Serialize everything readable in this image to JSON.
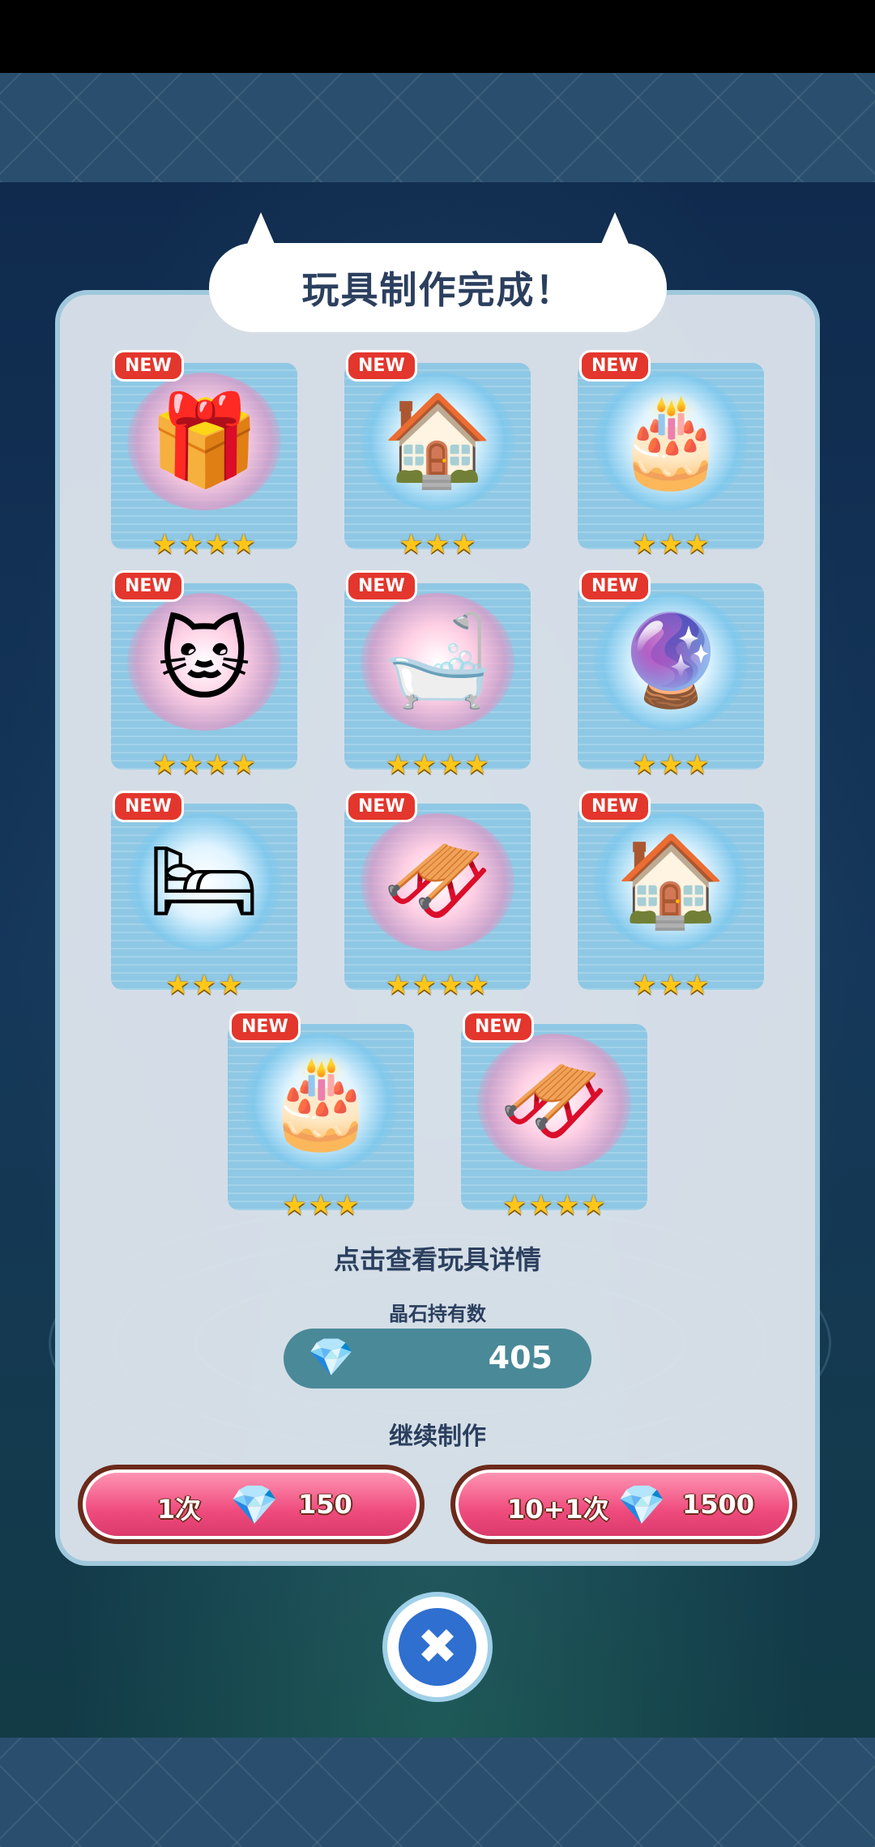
{
  "title": "玩具制作完成！",
  "new_badge": "NEW",
  "star_char": "★",
  "items": [
    {
      "toy_icon": "stacked-gift-boxes-icon",
      "emoji": "🎁",
      "stars": 4,
      "glow": "pink"
    },
    {
      "toy_icon": "gingerbread-house-icon",
      "emoji": "🏠",
      "stars": 3,
      "glow": "blue"
    },
    {
      "toy_icon": "christmas-cake-icon",
      "emoji": "🎂",
      "stars": 3,
      "glow": "blue"
    },
    {
      "toy_icon": "white-cat-icon",
      "emoji": "🐱",
      "stars": 4,
      "glow": "pink"
    },
    {
      "toy_icon": "bath-tub-toy-icon",
      "emoji": "🛁",
      "stars": 4,
      "glow": "pink"
    },
    {
      "toy_icon": "snow-globe-icon",
      "emoji": "🔮",
      "stars": 3,
      "glow": "blue"
    },
    {
      "toy_icon": "cat-bed-icon",
      "emoji": "🛏",
      "stars": 3,
      "glow": "blue"
    },
    {
      "toy_icon": "santa-sleigh-icon",
      "emoji": "🛷",
      "stars": 4,
      "glow": "pink"
    },
    {
      "toy_icon": "gingerbread-house-icon",
      "emoji": "🏠",
      "stars": 3,
      "glow": "blue"
    },
    {
      "toy_icon": "christmas-cake-icon",
      "emoji": "🎂",
      "stars": 3,
      "glow": "blue"
    },
    {
      "toy_icon": "santa-sleigh-icon",
      "emoji": "🛷",
      "stars": 4,
      "glow": "pink"
    }
  ],
  "hint": "点击查看玩具详情",
  "gems": {
    "label": "晶石持有数",
    "count": "405",
    "icon": "rainbow-crystal-icon"
  },
  "continue_label": "继续制作",
  "buttons": [
    {
      "label": "1次",
      "cost": "150"
    },
    {
      "label": "10+1次",
      "cost": "1500"
    }
  ],
  "close_icon": "close-icon",
  "close_glyph": "✖"
}
